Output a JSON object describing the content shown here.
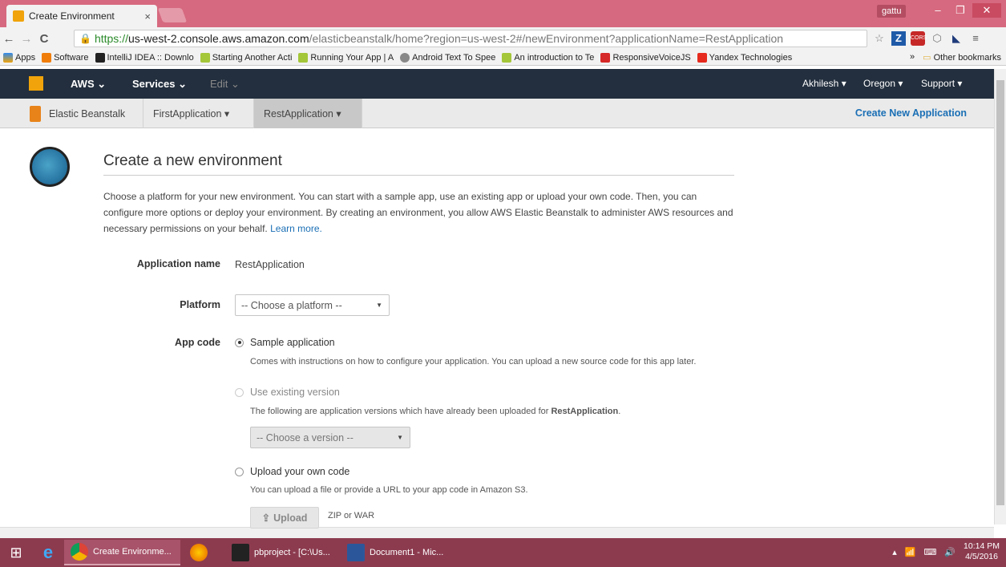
{
  "browser": {
    "tab_title": "Create Environment",
    "tab_close": "×",
    "profile": "gattu",
    "url_scheme": "https://",
    "url_host": "us-west-2.console.aws.amazon.com",
    "url_path": "/elasticbeanstalk/home?region=us-west-2#/newEnvironment?applicationName=RestApplication",
    "bookmarks": [
      "Apps",
      "Software",
      "IntelliJ IDEA :: Downlo",
      "Starting Another Acti",
      "Running Your App | A",
      "Android Text To Spee",
      "An introduction to Te",
      "ResponsiveVoiceJS",
      "Yandex Technologies"
    ],
    "bookmarks_more": "»",
    "other_bookmarks": "Other bookmarks"
  },
  "aws_nav": {
    "brand": "AWS ⌄",
    "services": "Services ⌄",
    "edit": "Edit ⌄",
    "user": "Akhilesh ▾",
    "region": "Oregon ▾",
    "support": "Support ▾"
  },
  "sub_nav": {
    "service": "Elastic Beanstalk",
    "app1": "FirstApplication ▾",
    "app2": "RestApplication ▾",
    "create_app": "Create New Application"
  },
  "page": {
    "title": "Create a new environment",
    "intro": "Choose a platform for your new environment. You can start with a sample app, use an existing app or upload your own code. Then, you can configure more options or deploy your environment. By creating an environment, you allow AWS Elastic Beanstalk to administer AWS resources and necessary permissions on your behalf.",
    "learn_more": "Learn more.",
    "app_name_label": "Application name",
    "app_name_value": "RestApplication",
    "platform_label": "Platform",
    "platform_placeholder": "-- Choose a platform --",
    "app_code_label": "App code",
    "opt_sample": "Sample application",
    "opt_sample_help": "Comes with instructions on how to configure your application. You can upload a new source code for this app later.",
    "opt_existing": "Use existing version",
    "opt_existing_help_prefix": "The following are application versions which have already been uploaded for ",
    "opt_existing_help_app": "RestApplication",
    "opt_existing_help_suffix": ".",
    "version_placeholder": "-- Choose a version --",
    "opt_upload": "Upload your own code",
    "opt_upload_help": "You can upload a file or provide a URL to your app code in Amazon S3.",
    "upload_button": "Upload",
    "upload_note": "ZIP or WAR"
  },
  "taskbar": {
    "apps": [
      "Create Environme...",
      "pbproject - [C:\\Us...",
      "Document1 - Mic..."
    ],
    "time": "10:14 PM",
    "date": "4/5/2016"
  },
  "colors": {
    "aws_nav_bg": "#232f3e",
    "link": "#1a6fb5",
    "titlebar": "#d6697f"
  }
}
